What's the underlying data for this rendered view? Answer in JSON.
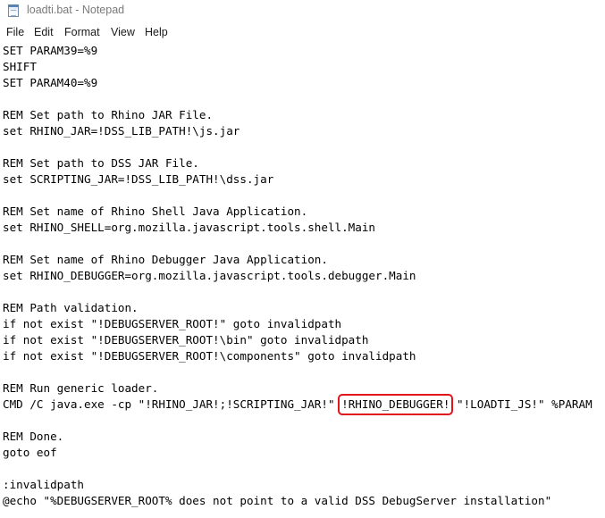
{
  "window": {
    "app_icon": "notepad-icon",
    "title": "loadti.bat - Notepad"
  },
  "menu": {
    "file": "File",
    "edit": "Edit",
    "format": "Format",
    "view": "View",
    "help": "Help"
  },
  "editor": {
    "lines": [
      "SET PARAM39=%9",
      "SHIFT",
      "SET PARAM40=%9",
      "",
      "REM Set path to Rhino JAR File.",
      "set RHINO_JAR=!DSS_LIB_PATH!\\js.jar",
      "",
      "REM Set path to DSS JAR File.",
      "set SCRIPTING_JAR=!DSS_LIB_PATH!\\dss.jar",
      "",
      "REM Set name of Rhino Shell Java Application.",
      "set RHINO_SHELL=org.mozilla.javascript.tools.shell.Main",
      "",
      "REM Set name of Rhino Debugger Java Application.",
      "set RHINO_DEBUGGER=org.mozilla.javascript.tools.debugger.Main",
      "",
      "REM Path validation.",
      "if not exist \"!DEBUGSERVER_ROOT!\" goto invalidpath",
      "if not exist \"!DEBUGSERVER_ROOT!\\bin\" goto invalidpath",
      "if not exist \"!DEBUGSERVER_ROOT!\\components\" goto invalidpath",
      "",
      "REM Run generic loader.",
      "",
      "",
      "REM Done.",
      "goto eof",
      "",
      ":invalidpath",
      "@echo \"%DEBUGSERVER_ROOT% does not point to a valid DSS DebugServer installation\""
    ],
    "cmd_line": {
      "before": "CMD /C java.exe -cp \"!RHINO_JAR!;!SCRIPTING_JAR!\" ",
      "highlighted": "!RHINO_DEBUGGER!",
      "after": " \"!LOADTI_JS!\" %PARAM"
    }
  },
  "colors": {
    "highlight_border": "#e0161b",
    "title_text": "#7a7a7a"
  }
}
